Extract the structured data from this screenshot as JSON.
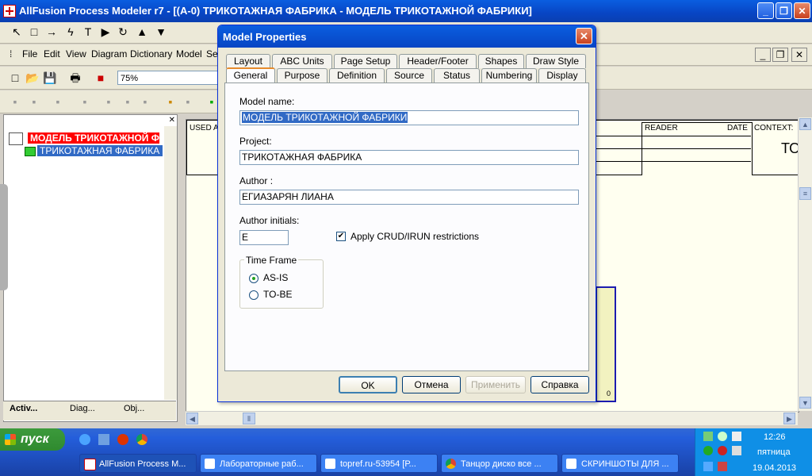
{
  "app": {
    "title": "AllFusion Process Modeler r7 - [(A-0) ТРИКОТАЖНАЯ ФАБРИКА - МОДЕЛЬ ТРИКОТАЖНОЙ ФАБРИКИ]",
    "minimize": "_",
    "restore": "❐",
    "close": "✕"
  },
  "draw_toolbar": [
    "↖",
    "□",
    "→",
    "ϟ",
    "T",
    "▶",
    "↻",
    "▲",
    "▼"
  ],
  "menu": {
    "items": [
      "File",
      "Edit",
      "View",
      "Diagram",
      "Dictionary",
      "Model",
      "Se"
    ],
    "mdi_minimize": "_",
    "mdi_restore": "❐",
    "mdi_close": "✕"
  },
  "std_toolbar": {
    "zoom": "75%",
    "icons": [
      "□",
      "📂",
      "💾",
      "🖶",
      "■"
    ]
  },
  "tree": {
    "root": "МОДЕЛЬ ТРИКОТАЖНОЙ ФАБРИКИ",
    "child": "ТРИКОТАЖНАЯ ФАБРИКА",
    "close": "✕"
  },
  "left_tabs": [
    "Activ...",
    "Diag...",
    "Obj..."
  ],
  "diagram": {
    "used_at": "USED A",
    "reader": "READER",
    "date": "DATE",
    "context": "CONTEXT:",
    "context_value": "ТО",
    "box_number": "0"
  },
  "dialog": {
    "title": "Model Properties",
    "close": "✕",
    "tabs_row1": [
      "Layout",
      "ABC Units",
      "Page Setup",
      "Header/Footer",
      "Shapes",
      "Draw Style"
    ],
    "tabs_row2": [
      "General",
      "Purpose",
      "Definition",
      "Source",
      "Status",
      "Numbering",
      "Display"
    ],
    "model_name_label": "Model name:",
    "model_name": "МОДЕЛЬ ТРИКОТАЖНОЙ ФАБРИКИ",
    "project_label": "Project:",
    "project": "ТРИКОТАЖНАЯ ФАБРИКА",
    "author_label": "Author :",
    "author": "ЕГИАЗАРЯН ЛИАНА",
    "initials_label": "Author initials:",
    "initials": "Е",
    "crud_label": "Apply CRUD/IRUN restrictions",
    "crud_checked": "✔",
    "time_frame_label": "Time Frame",
    "as_is": "AS-IS",
    "to_be": "TO-BE",
    "ok": "OK",
    "cancel": "Отмена",
    "apply": "Применить",
    "help": "Справка"
  },
  "taskbar": {
    "start": "пуск",
    "tasks": [
      "AllFusion Process M...",
      "Лабораторные раб...",
      "topref.ru-53954 [Р...",
      "Танцор диско все ...",
      "СКРИНШОТЫ ДЛЯ ..."
    ],
    "time": "12:26",
    "day": "пятница",
    "date": "19.04.2013"
  }
}
